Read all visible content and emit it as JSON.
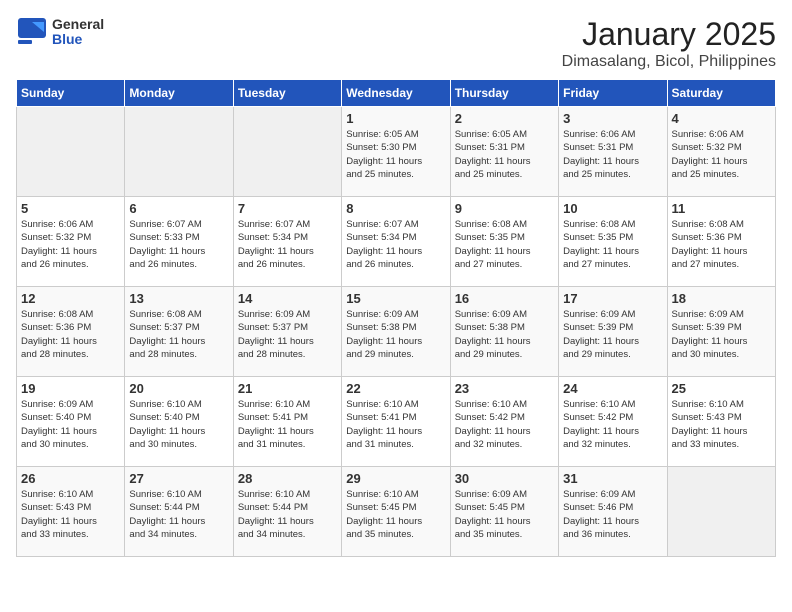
{
  "logo": {
    "text_general": "General",
    "text_blue": "Blue"
  },
  "title": "January 2025",
  "subtitle": "Dimasalang, Bicol, Philippines",
  "weekdays": [
    "Sunday",
    "Monday",
    "Tuesday",
    "Wednesday",
    "Thursday",
    "Friday",
    "Saturday"
  ],
  "weeks": [
    [
      {
        "day": "",
        "info": ""
      },
      {
        "day": "",
        "info": ""
      },
      {
        "day": "",
        "info": ""
      },
      {
        "day": "1",
        "info": "Sunrise: 6:05 AM\nSunset: 5:30 PM\nDaylight: 11 hours\nand 25 minutes."
      },
      {
        "day": "2",
        "info": "Sunrise: 6:05 AM\nSunset: 5:31 PM\nDaylight: 11 hours\nand 25 minutes."
      },
      {
        "day": "3",
        "info": "Sunrise: 6:06 AM\nSunset: 5:31 PM\nDaylight: 11 hours\nand 25 minutes."
      },
      {
        "day": "4",
        "info": "Sunrise: 6:06 AM\nSunset: 5:32 PM\nDaylight: 11 hours\nand 25 minutes."
      }
    ],
    [
      {
        "day": "5",
        "info": "Sunrise: 6:06 AM\nSunset: 5:32 PM\nDaylight: 11 hours\nand 26 minutes."
      },
      {
        "day": "6",
        "info": "Sunrise: 6:07 AM\nSunset: 5:33 PM\nDaylight: 11 hours\nand 26 minutes."
      },
      {
        "day": "7",
        "info": "Sunrise: 6:07 AM\nSunset: 5:34 PM\nDaylight: 11 hours\nand 26 minutes."
      },
      {
        "day": "8",
        "info": "Sunrise: 6:07 AM\nSunset: 5:34 PM\nDaylight: 11 hours\nand 26 minutes."
      },
      {
        "day": "9",
        "info": "Sunrise: 6:08 AM\nSunset: 5:35 PM\nDaylight: 11 hours\nand 27 minutes."
      },
      {
        "day": "10",
        "info": "Sunrise: 6:08 AM\nSunset: 5:35 PM\nDaylight: 11 hours\nand 27 minutes."
      },
      {
        "day": "11",
        "info": "Sunrise: 6:08 AM\nSunset: 5:36 PM\nDaylight: 11 hours\nand 27 minutes."
      }
    ],
    [
      {
        "day": "12",
        "info": "Sunrise: 6:08 AM\nSunset: 5:36 PM\nDaylight: 11 hours\nand 28 minutes."
      },
      {
        "day": "13",
        "info": "Sunrise: 6:08 AM\nSunset: 5:37 PM\nDaylight: 11 hours\nand 28 minutes."
      },
      {
        "day": "14",
        "info": "Sunrise: 6:09 AM\nSunset: 5:37 PM\nDaylight: 11 hours\nand 28 minutes."
      },
      {
        "day": "15",
        "info": "Sunrise: 6:09 AM\nSunset: 5:38 PM\nDaylight: 11 hours\nand 29 minutes."
      },
      {
        "day": "16",
        "info": "Sunrise: 6:09 AM\nSunset: 5:38 PM\nDaylight: 11 hours\nand 29 minutes."
      },
      {
        "day": "17",
        "info": "Sunrise: 6:09 AM\nSunset: 5:39 PM\nDaylight: 11 hours\nand 29 minutes."
      },
      {
        "day": "18",
        "info": "Sunrise: 6:09 AM\nSunset: 5:39 PM\nDaylight: 11 hours\nand 30 minutes."
      }
    ],
    [
      {
        "day": "19",
        "info": "Sunrise: 6:09 AM\nSunset: 5:40 PM\nDaylight: 11 hours\nand 30 minutes."
      },
      {
        "day": "20",
        "info": "Sunrise: 6:10 AM\nSunset: 5:40 PM\nDaylight: 11 hours\nand 30 minutes."
      },
      {
        "day": "21",
        "info": "Sunrise: 6:10 AM\nSunset: 5:41 PM\nDaylight: 11 hours\nand 31 minutes."
      },
      {
        "day": "22",
        "info": "Sunrise: 6:10 AM\nSunset: 5:41 PM\nDaylight: 11 hours\nand 31 minutes."
      },
      {
        "day": "23",
        "info": "Sunrise: 6:10 AM\nSunset: 5:42 PM\nDaylight: 11 hours\nand 32 minutes."
      },
      {
        "day": "24",
        "info": "Sunrise: 6:10 AM\nSunset: 5:42 PM\nDaylight: 11 hours\nand 32 minutes."
      },
      {
        "day": "25",
        "info": "Sunrise: 6:10 AM\nSunset: 5:43 PM\nDaylight: 11 hours\nand 33 minutes."
      }
    ],
    [
      {
        "day": "26",
        "info": "Sunrise: 6:10 AM\nSunset: 5:43 PM\nDaylight: 11 hours\nand 33 minutes."
      },
      {
        "day": "27",
        "info": "Sunrise: 6:10 AM\nSunset: 5:44 PM\nDaylight: 11 hours\nand 34 minutes."
      },
      {
        "day": "28",
        "info": "Sunrise: 6:10 AM\nSunset: 5:44 PM\nDaylight: 11 hours\nand 34 minutes."
      },
      {
        "day": "29",
        "info": "Sunrise: 6:10 AM\nSunset: 5:45 PM\nDaylight: 11 hours\nand 35 minutes."
      },
      {
        "day": "30",
        "info": "Sunrise: 6:09 AM\nSunset: 5:45 PM\nDaylight: 11 hours\nand 35 minutes."
      },
      {
        "day": "31",
        "info": "Sunrise: 6:09 AM\nSunset: 5:46 PM\nDaylight: 11 hours\nand 36 minutes."
      },
      {
        "day": "",
        "info": ""
      }
    ]
  ]
}
